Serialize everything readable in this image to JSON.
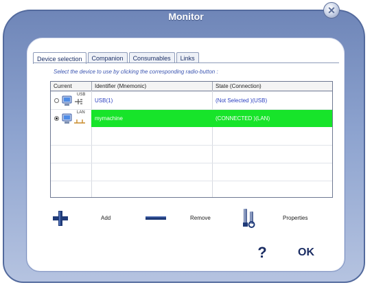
{
  "window": {
    "title": "Monitor",
    "close_icon": "close-icon"
  },
  "tabs": [
    {
      "label": "Device selection",
      "active": true
    },
    {
      "label": "Companion",
      "active": false
    },
    {
      "label": "Consumables",
      "active": false
    },
    {
      "label": "Links",
      "active": false
    }
  ],
  "instruction": "Select the device to use by clicking the corresponding radio-button :",
  "grid": {
    "columns": [
      "Current",
      "Identifier (Mnemonic)",
      "State (Connection)"
    ],
    "rows": [
      {
        "selected": false,
        "connection": "USB",
        "icon": "usb-computer-icon",
        "identifier": "USB(1)",
        "state": "(Not Selected )(USB)"
      },
      {
        "selected": true,
        "connection": "LAN",
        "icon": "lan-computer-icon",
        "identifier": "mymachine",
        "state": "(CONNECTED )(LAN)"
      }
    ],
    "selected_color": "#17e42a"
  },
  "toolbar": {
    "add_label": "Add",
    "remove_label": "Remove",
    "properties_label": "Properties",
    "help_label": "?",
    "ok_label": "OK"
  },
  "colors": {
    "frame": "#6f86b8",
    "accent_text": "#2a3fc0",
    "icon_dark": "#1b2d63"
  }
}
